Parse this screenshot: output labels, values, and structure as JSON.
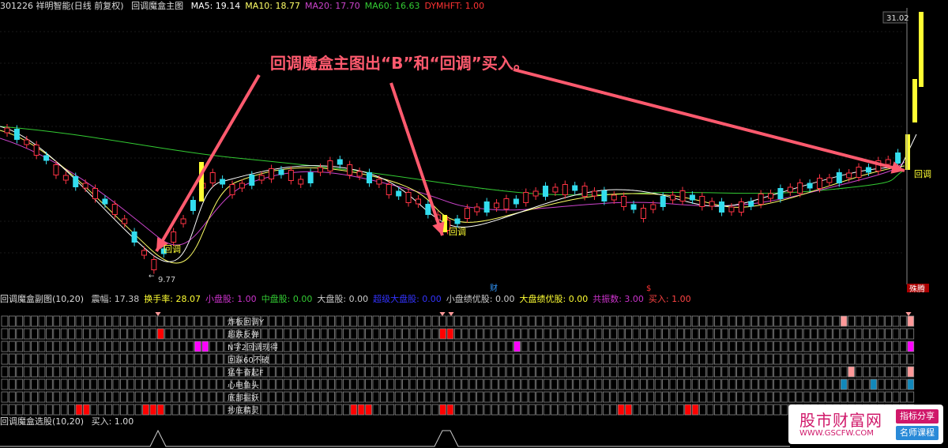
{
  "header": {
    "code_name": "301226 祥明智能(日线 前复权)",
    "indicator": "回调魔盒主图",
    "ma": [
      {
        "label": "MA5: 19.14",
        "color": "#ffffff"
      },
      {
        "label": "MA10: 18.77",
        "color": "#ffff66"
      },
      {
        "label": "MA20: 17.70",
        "color": "#cc44cc"
      },
      {
        "label": "MA60: 16.63",
        "color": "#33cc33"
      },
      {
        "label": "DYMHFT: 1.00",
        "color": "#ff3333"
      }
    ]
  },
  "main": {
    "high_label": "31.02",
    "low_label": "9.77",
    "annotation": "回调魔盒主图出“B”和“回调”买入。",
    "signal_label": "回调",
    "bottom_markers": [
      "财",
      "$",
      "殊腾"
    ]
  },
  "sub": {
    "title": "回调魔盒副图(10,20)",
    "values": [
      {
        "label": "震幅: 17.38",
        "color": "#cccccc"
      },
      {
        "label": "换手率: 28.07",
        "color": "#ffff33"
      },
      {
        "label": "小盘股: 1.00",
        "color": "#cc33cc"
      },
      {
        "label": "中盘股: 0.00",
        "color": "#33cc33"
      },
      {
        "label": "大盘股: 0.00",
        "color": "#cccccc"
      },
      {
        "label": "超级大盘股: 0.00",
        "color": "#3333ff"
      },
      {
        "label": "小盘绩优股: 0.00",
        "color": "#cccccc"
      },
      {
        "label": "大盘绩优股: 0.00",
        "color": "#ffff33"
      },
      {
        "label": "共振数: 3.00",
        "color": "#cc33cc"
      },
      {
        "label": "买入: 1.00",
        "color": "#ff4444"
      }
    ],
    "rows": [
      "炸板回调Y",
      "超跌反弹",
      "N字2回调现得",
      "回踩60不破",
      "猛牛奋起F",
      "心电鱼头",
      "底部掘妖",
      "抄底精灵"
    ]
  },
  "select": {
    "title": "回调魔盒选股(10,20)",
    "value": "买入: 1.00"
  },
  "watermark": {
    "title": "股市财富网",
    "url": "WWW.GSCFW.COM",
    "tag1": "指标分享",
    "tag2": "名师课程"
  },
  "colors": {
    "up": "#ff3344",
    "down": "#33ddee",
    "annotation": "#ff5a6e",
    "signal_yellow": "#ffff33"
  }
}
